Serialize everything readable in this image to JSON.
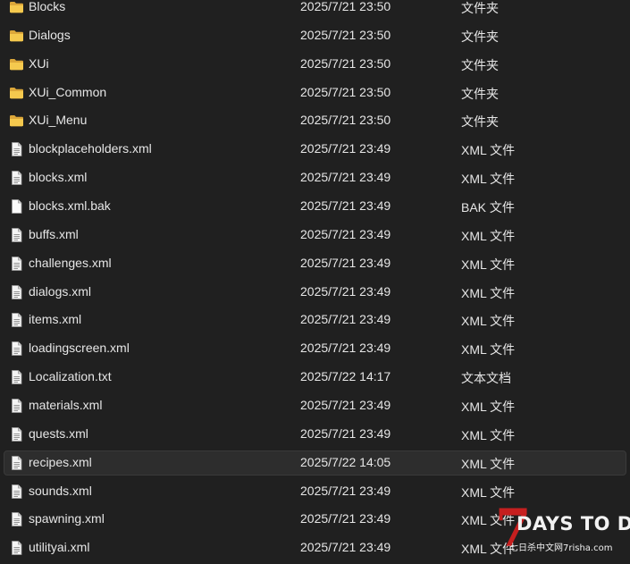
{
  "files": [
    {
      "name": "Blocks",
      "date": "2025/7/21 23:50",
      "type": "文件夹",
      "icon": "folder-icon"
    },
    {
      "name": "Dialogs",
      "date": "2025/7/21 23:50",
      "type": "文件夹",
      "icon": "folder-icon"
    },
    {
      "name": "XUi",
      "date": "2025/7/21 23:50",
      "type": "文件夹",
      "icon": "folder-icon"
    },
    {
      "name": "XUi_Common",
      "date": "2025/7/21 23:50",
      "type": "文件夹",
      "icon": "folder-icon"
    },
    {
      "name": "XUi_Menu",
      "date": "2025/7/21 23:50",
      "type": "文件夹",
      "icon": "folder-icon"
    },
    {
      "name": "blockplaceholders.xml",
      "date": "2025/7/21 23:49",
      "type": "XML 文件",
      "icon": "file-icon"
    },
    {
      "name": "blocks.xml",
      "date": "2025/7/21 23:49",
      "type": "XML 文件",
      "icon": "file-icon"
    },
    {
      "name": "blocks.xml.bak",
      "date": "2025/7/21 23:49",
      "type": "BAK 文件",
      "icon": "blank-file-icon"
    },
    {
      "name": "buffs.xml",
      "date": "2025/7/21 23:49",
      "type": "XML 文件",
      "icon": "file-icon"
    },
    {
      "name": "challenges.xml",
      "date": "2025/7/21 23:49",
      "type": "XML 文件",
      "icon": "file-icon"
    },
    {
      "name": "dialogs.xml",
      "date": "2025/7/21 23:49",
      "type": "XML 文件",
      "icon": "file-icon"
    },
    {
      "name": "items.xml",
      "date": "2025/7/21 23:49",
      "type": "XML 文件",
      "icon": "file-icon"
    },
    {
      "name": "loadingscreen.xml",
      "date": "2025/7/21 23:49",
      "type": "XML 文件",
      "icon": "file-icon"
    },
    {
      "name": "Localization.txt",
      "date": "2025/7/22 14:17",
      "type": "文本文档",
      "icon": "file-icon"
    },
    {
      "name": "materials.xml",
      "date": "2025/7/21 23:49",
      "type": "XML 文件",
      "icon": "file-icon"
    },
    {
      "name": "quests.xml",
      "date": "2025/7/21 23:49",
      "type": "XML 文件",
      "icon": "file-icon"
    },
    {
      "name": "recipes.xml",
      "date": "2025/7/22 14:05",
      "type": "XML 文件",
      "icon": "file-icon",
      "selected": true
    },
    {
      "name": "sounds.xml",
      "date": "2025/7/21 23:49",
      "type": "XML 文件",
      "icon": "file-icon"
    },
    {
      "name": "spawning.xml",
      "date": "2025/7/21 23:49",
      "type": "XML 文件",
      "icon": "file-icon"
    },
    {
      "name": "utilityai.xml",
      "date": "2025/7/21 23:49",
      "type": "XML 文件",
      "icon": "file-icon"
    }
  ],
  "watermark": {
    "seven": "7",
    "title": "DAYS TO DIE",
    "subtitle": "七日杀中文网7risha.com"
  },
  "colors": {
    "background": "#202020",
    "text": "#e6e6e6",
    "folder": "#f0c04a",
    "selection": "#2d2d2d",
    "watermark_red": "#c61f1f"
  }
}
